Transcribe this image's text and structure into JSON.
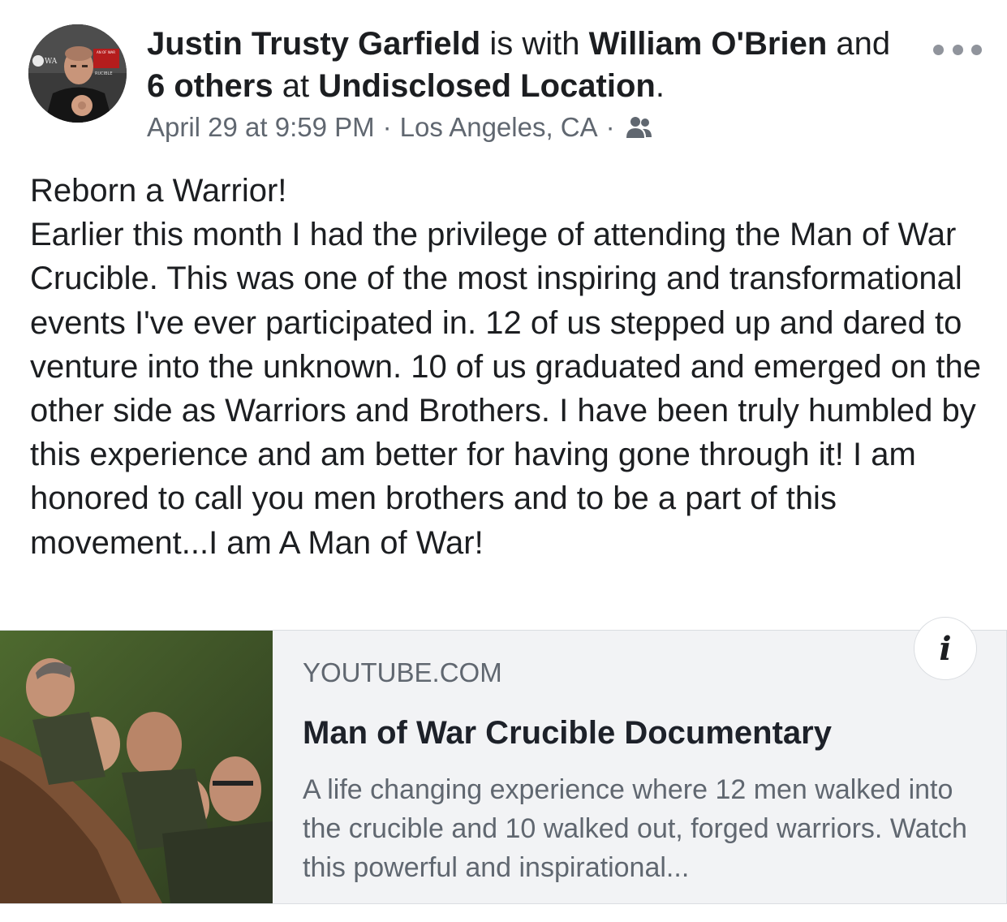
{
  "post": {
    "author": "Justin Trusty Garfield",
    "with_text": "is with",
    "tagged_person": "William O'Brien",
    "and_text": "and",
    "others": "6 others",
    "at_text": "at",
    "place": "Undisclosed Location",
    "period": ".",
    "timestamp": "April 29 at 9:59 PM",
    "separator": "·",
    "location": "Los Angeles, CA",
    "audience_icon": "friends-icon",
    "body": "Reborn a Warrior!\nEarlier this month I had the privilege of attending the Man of War Crucible. This was one of the most inspiring and transformational events I've ever participated in. 12 of us stepped up and dared to venture into the unknown. 10 of us graduated and emerged on the other side as Warriors and Brothers. I have been truly humbled by this experience and am better for having gone through it! I am honored to call you men brothers and to be a part of this movement...I am A Man of War!"
  },
  "link_preview": {
    "domain": "YOUTUBE.COM",
    "title": "Man of War Crucible Documentary",
    "description": "A life changing experience where 12 men walked into the crucible and 10 walked out, forged warriors. Watch this powerful and inspirational...",
    "info_label": "i"
  },
  "avatar": {
    "logo_text": "WA",
    "badge_text": "AN OF WAR",
    "banner_text": "RUCIBLE"
  },
  "colors": {
    "primary_text": "#1c1e21",
    "secondary_text": "#606770",
    "card_bg": "#f2f3f5",
    "border": "#dadde1",
    "more_dots": "#90949c"
  }
}
